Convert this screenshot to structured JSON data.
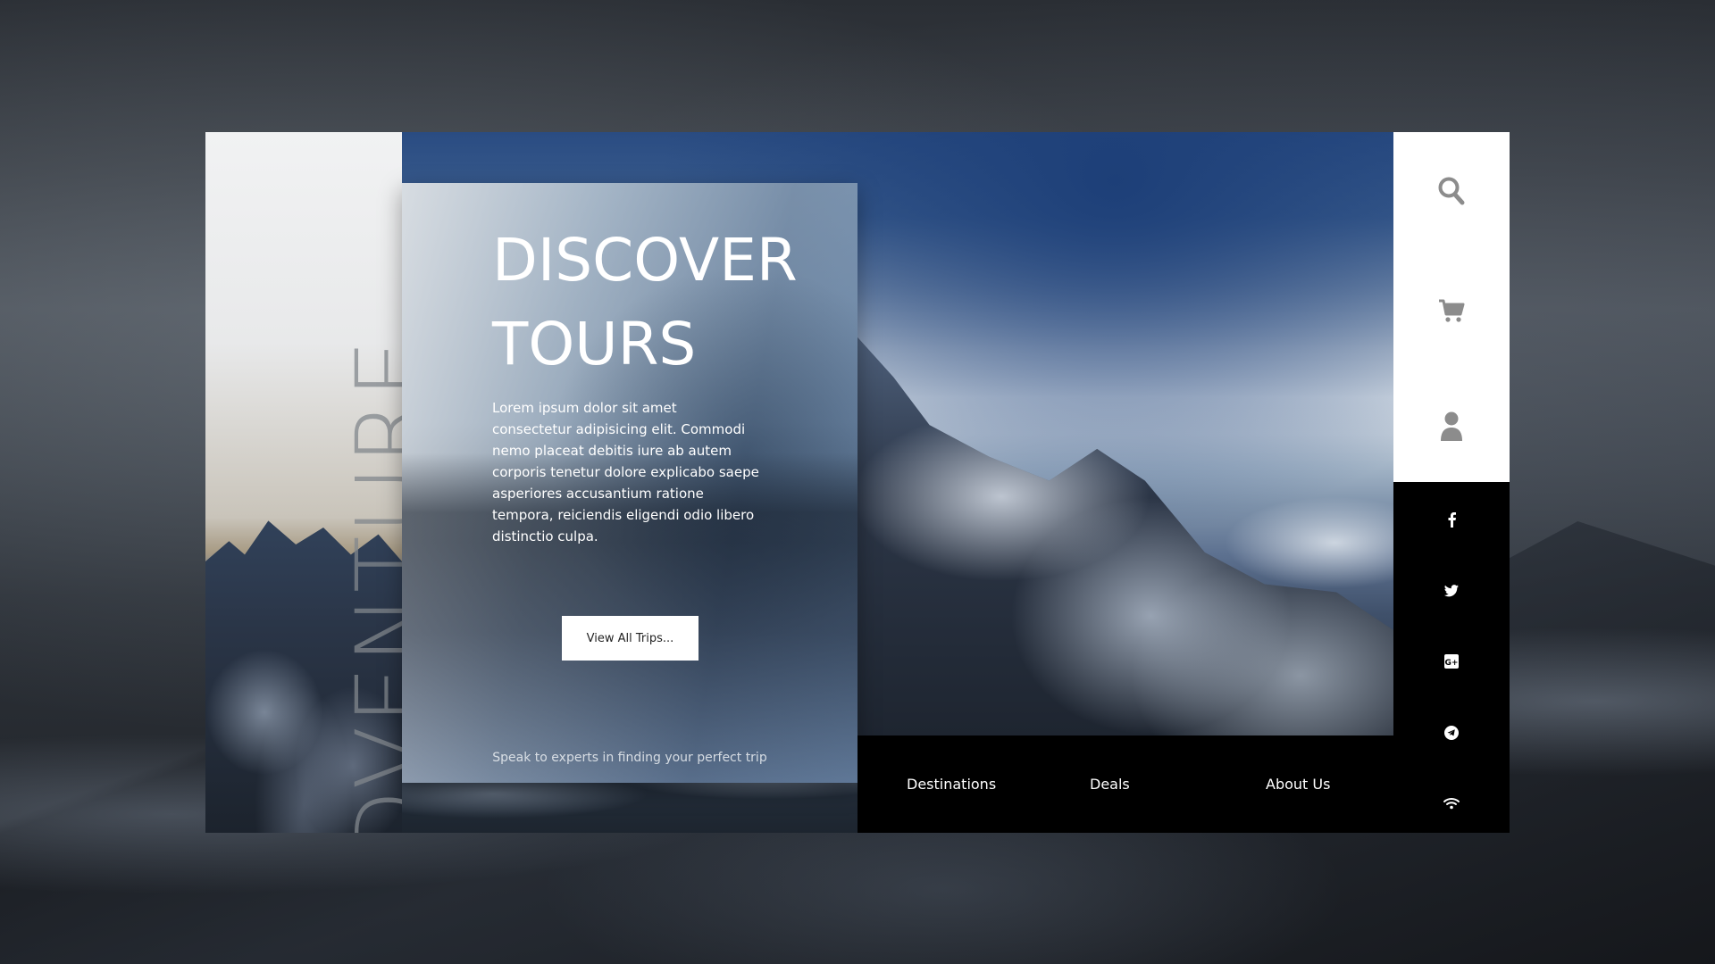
{
  "hero": {
    "vertical_word": "ADVENTURE",
    "title_line1": "DISCOVER",
    "title_line2": "TOURS",
    "body": "Lorem ipsum dolor sit amet consectetur adipisicing elit. Commodi nemo placeat debitis iure ab autem corporis tenetur dolore explicabo saepe asperiores accusantium ratione tempora, reiciendis eligendi odio libero distinctio culpa.",
    "cta_label": "View All Trips...",
    "footer_text": "Speak to experts in finding your perfect trip"
  },
  "nav": {
    "items": [
      {
        "label": "Destinations"
      },
      {
        "label": "Deals"
      },
      {
        "label": "About Us"
      }
    ]
  },
  "sidebar": {
    "top_icons": [
      "search-icon",
      "cart-icon",
      "user-icon"
    ],
    "social_icons": [
      "facebook-icon",
      "twitter-icon",
      "google-plus-icon",
      "telegram-icon",
      "wifi-icon"
    ]
  },
  "colors": {
    "sidebar_light": "#ffffff",
    "sidebar_dark": "#000000",
    "nav_bg": "#000000",
    "icon_gray": "#8c8c8c",
    "button_bg": "#ffffff"
  }
}
